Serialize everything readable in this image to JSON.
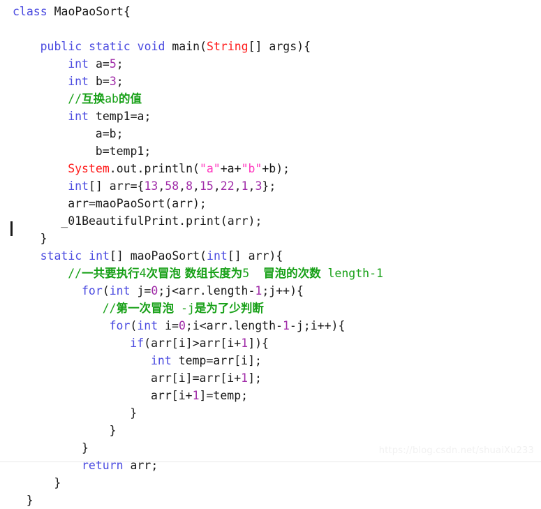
{
  "editor": {
    "language": "Java",
    "caret": {
      "line_index": 12,
      "column": 0,
      "visible": true
    },
    "colors": {
      "background": "#ffffff",
      "default_text": "#1a1a1a",
      "keyword": "#4b4be0",
      "type": "#ff1a1a",
      "number": "#a02ba8",
      "string": "#ff38bf",
      "comment": "#17a017"
    }
  },
  "watermark": {
    "text": "https://blog.csdn.net/shuaiXu233"
  },
  "code": {
    "lines": [
      {
        "indent": 0,
        "tokens": [
          {
            "t": "class ",
            "c": "kw"
          },
          {
            "t": "MaoPaoSort{",
            "c": "plain"
          }
        ]
      },
      {
        "indent": 0,
        "tokens": []
      },
      {
        "indent": 4,
        "tokens": [
          {
            "t": "public static void ",
            "c": "kw"
          },
          {
            "t": "main(",
            "c": "plain"
          },
          {
            "t": "String",
            "c": "type"
          },
          {
            "t": "[] args){",
            "c": "plain"
          }
        ]
      },
      {
        "indent": 8,
        "tokens": [
          {
            "t": "int ",
            "c": "kw"
          },
          {
            "t": "a=",
            "c": "plain"
          },
          {
            "t": "5",
            "c": "num"
          },
          {
            "t": ";",
            "c": "plain"
          }
        ]
      },
      {
        "indent": 8,
        "tokens": [
          {
            "t": "int ",
            "c": "kw"
          },
          {
            "t": "b=",
            "c": "plain"
          },
          {
            "t": "3",
            "c": "num"
          },
          {
            "t": ";",
            "c": "plain"
          }
        ]
      },
      {
        "indent": 8,
        "tokens": [
          {
            "t": "//",
            "c": "cmt"
          },
          {
            "t": "互换",
            "c": "cmt",
            "cjk": true
          },
          {
            "t": "ab",
            "c": "cmt"
          },
          {
            "t": "的值",
            "c": "cmt",
            "cjk": true
          }
        ]
      },
      {
        "indent": 8,
        "tokens": [
          {
            "t": "int ",
            "c": "kw"
          },
          {
            "t": "temp1=a;",
            "c": "plain"
          }
        ]
      },
      {
        "indent": 12,
        "tokens": [
          {
            "t": "a=b;",
            "c": "plain"
          }
        ]
      },
      {
        "indent": 12,
        "tokens": [
          {
            "t": "b=temp1;",
            "c": "plain"
          }
        ]
      },
      {
        "indent": 8,
        "tokens": [
          {
            "t": "System",
            "c": "type"
          },
          {
            "t": ".out.println(",
            "c": "plain"
          },
          {
            "t": "\"a\"",
            "c": "str"
          },
          {
            "t": "+a+",
            "c": "plain"
          },
          {
            "t": "\"b\"",
            "c": "str"
          },
          {
            "t": "+b);",
            "c": "plain"
          }
        ]
      },
      {
        "indent": 8,
        "tokens": [
          {
            "t": "int",
            "c": "kw"
          },
          {
            "t": "[] arr={",
            "c": "plain"
          },
          {
            "t": "13",
            "c": "num"
          },
          {
            "t": ",",
            "c": "plain"
          },
          {
            "t": "58",
            "c": "num"
          },
          {
            "t": ",",
            "c": "plain"
          },
          {
            "t": "8",
            "c": "num"
          },
          {
            "t": ",",
            "c": "plain"
          },
          {
            "t": "15",
            "c": "num"
          },
          {
            "t": ",",
            "c": "plain"
          },
          {
            "t": "22",
            "c": "num"
          },
          {
            "t": ",",
            "c": "plain"
          },
          {
            "t": "1",
            "c": "num"
          },
          {
            "t": ",",
            "c": "plain"
          },
          {
            "t": "3",
            "c": "num"
          },
          {
            "t": "};",
            "c": "plain"
          }
        ]
      },
      {
        "indent": 8,
        "tokens": [
          {
            "t": "arr=maoPaoSort(arr);",
            "c": "plain"
          }
        ]
      },
      {
        "indent": 7,
        "tokens": [
          {
            "t": "_01BeautifulPrint.print(arr);",
            "c": "plain"
          }
        ]
      },
      {
        "indent": 4,
        "tokens": [
          {
            "t": "}",
            "c": "plain"
          }
        ]
      },
      {
        "indent": 4,
        "tokens": [
          {
            "t": "static int",
            "c": "kw"
          },
          {
            "t": "[] maoPaoSort(",
            "c": "plain"
          },
          {
            "t": "int",
            "c": "kw"
          },
          {
            "t": "[] arr){",
            "c": "plain"
          }
        ]
      },
      {
        "indent": 8,
        "tokens": [
          {
            "t": "//",
            "c": "cmt"
          },
          {
            "t": "一共要执行",
            "c": "cmt",
            "cjk": true
          },
          {
            "t": "4",
            "c": "cmt"
          },
          {
            "t": "次冒泡 数组长度为",
            "c": "cmt",
            "cjk": true
          },
          {
            "t": "5",
            "c": "cmt"
          },
          {
            "t": "  ",
            "c": "cmt"
          },
          {
            "t": "冒泡的次数",
            "c": "cmt",
            "cjk": true
          },
          {
            "t": " length-1",
            "c": "cmt"
          }
        ]
      },
      {
        "indent": 10,
        "tokens": [
          {
            "t": "for",
            "c": "kw"
          },
          {
            "t": "(",
            "c": "plain"
          },
          {
            "t": "int ",
            "c": "kw"
          },
          {
            "t": "j=",
            "c": "plain"
          },
          {
            "t": "0",
            "c": "num"
          },
          {
            "t": ";j<arr.length-",
            "c": "plain"
          },
          {
            "t": "1",
            "c": "num"
          },
          {
            "t": ";j++){",
            "c": "plain"
          }
        ]
      },
      {
        "indent": 13,
        "tokens": [
          {
            "t": "//",
            "c": "cmt"
          },
          {
            "t": "第一次冒泡",
            "c": "cmt",
            "cjk": true
          },
          {
            "t": " -j",
            "c": "cmt"
          },
          {
            "t": "是为了少判断",
            "c": "cmt",
            "cjk": true
          }
        ]
      },
      {
        "indent": 14,
        "tokens": [
          {
            "t": "for",
            "c": "kw"
          },
          {
            "t": "(",
            "c": "plain"
          },
          {
            "t": "int ",
            "c": "kw"
          },
          {
            "t": "i=",
            "c": "plain"
          },
          {
            "t": "0",
            "c": "num"
          },
          {
            "t": ";i<arr.length-",
            "c": "plain"
          },
          {
            "t": "1",
            "c": "num"
          },
          {
            "t": "-j;i++){",
            "c": "plain"
          }
        ]
      },
      {
        "indent": 17,
        "tokens": [
          {
            "t": "if",
            "c": "kw"
          },
          {
            "t": "(arr[i]>arr[i+",
            "c": "plain"
          },
          {
            "t": "1",
            "c": "num"
          },
          {
            "t": "]){",
            "c": "plain"
          }
        ]
      },
      {
        "indent": 20,
        "tokens": [
          {
            "t": "int ",
            "c": "kw"
          },
          {
            "t": "temp=arr[i];",
            "c": "plain"
          }
        ]
      },
      {
        "indent": 20,
        "tokens": [
          {
            "t": "arr[i]=arr[i+",
            "c": "plain"
          },
          {
            "t": "1",
            "c": "num"
          },
          {
            "t": "];",
            "c": "plain"
          }
        ]
      },
      {
        "indent": 20,
        "tokens": [
          {
            "t": "arr[i+",
            "c": "plain"
          },
          {
            "t": "1",
            "c": "num"
          },
          {
            "t": "]=temp;",
            "c": "plain"
          }
        ]
      },
      {
        "indent": 17,
        "tokens": [
          {
            "t": "}",
            "c": "plain"
          }
        ]
      },
      {
        "indent": 14,
        "tokens": [
          {
            "t": "}",
            "c": "plain"
          }
        ]
      },
      {
        "indent": 10,
        "tokens": [
          {
            "t": "}",
            "c": "plain"
          }
        ]
      },
      {
        "indent": 10,
        "tokens": [
          {
            "t": "return ",
            "c": "kw"
          },
          {
            "t": "arr;",
            "c": "plain"
          }
        ]
      },
      {
        "indent": 6,
        "tokens": [
          {
            "t": "}",
            "c": "plain"
          }
        ]
      },
      {
        "indent": 2,
        "tokens": [
          {
            "t": "}",
            "c": "plain"
          }
        ]
      }
    ]
  }
}
